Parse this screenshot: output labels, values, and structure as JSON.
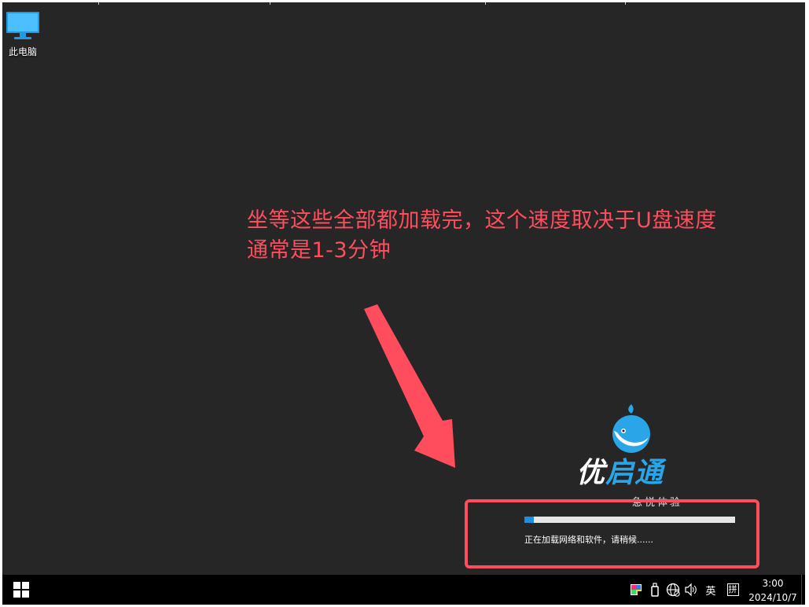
{
  "desktop": {
    "icon_label": "此电脑",
    "background_color": "#262626"
  },
  "annotation": {
    "line1": "坐等这些全部都加载完，这个速度取决于U盘速度",
    "line2": "通常是1-3分钟",
    "color": "#ff4d5e"
  },
  "loader": {
    "logo_part1": "优",
    "logo_part2": "启通",
    "tagline": "急悦体验",
    "progress_fraction": 0.045,
    "status": "正在加载网络和软件，请稍候......",
    "accent_color": "#2aa6e8"
  },
  "taskbar": {
    "ime_label": "英",
    "ime_mode": "拼",
    "time": "3:00",
    "date": "2024/10/7"
  },
  "icons": {
    "start": "windows-logo-icon",
    "color_tray": "color-palette-icon",
    "usb": "usb-drive-icon",
    "network": "globe-network-icon",
    "volume": "speaker-volume-icon",
    "desktop_pc": "monitor-computer-icon"
  }
}
